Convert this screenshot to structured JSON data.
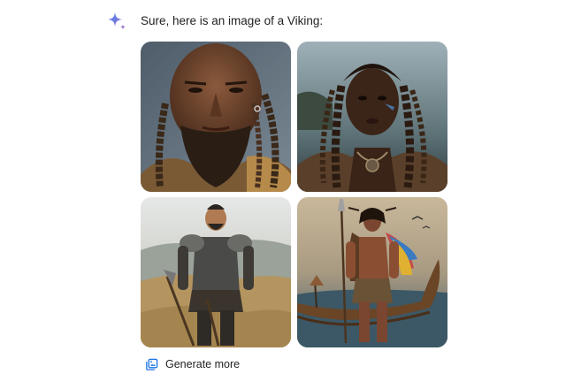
{
  "assistant": {
    "icon": "sparkle-icon",
    "message": "Sure, here is an image of a Viking:"
  },
  "images": [
    {
      "subject": "bald-man-with-braided-beard-portrait"
    },
    {
      "subject": "woman-with-braids-portrait"
    },
    {
      "subject": "armored-warrior-on-hills"
    },
    {
      "subject": "warrior-with-spear-by-longship"
    }
  ],
  "actions": {
    "generate_more_label": "Generate more",
    "generate_more_icon": "image-stack-icon"
  },
  "colors": {
    "sparkle_blue": "#4285f4",
    "sparkle_purple": "#9b72cb",
    "accent_blue": "#1a73e8",
    "text": "#1f1f1f"
  }
}
